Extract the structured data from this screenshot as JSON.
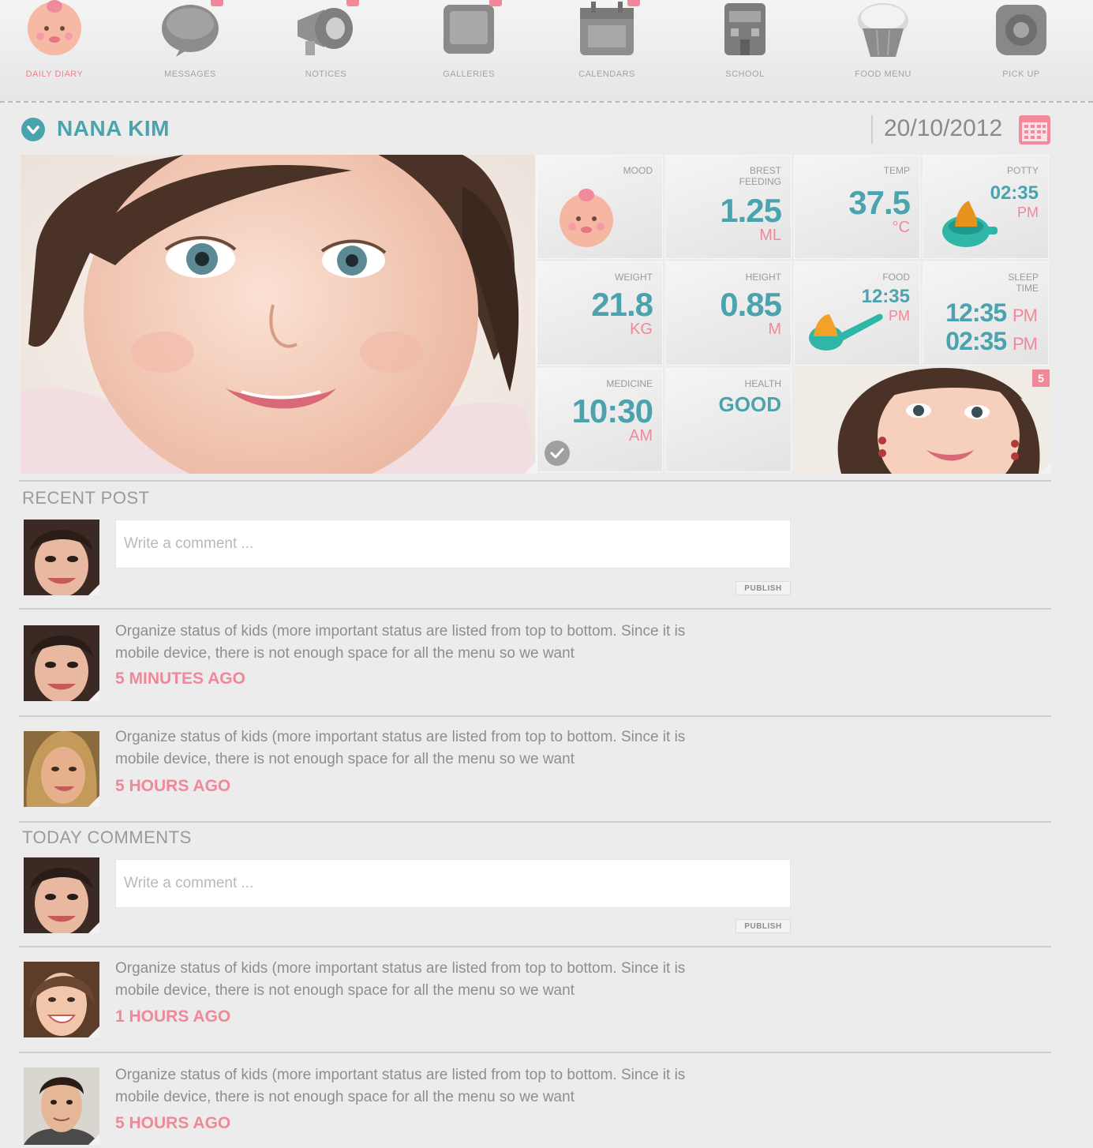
{
  "nav": {
    "items": [
      {
        "label": "Daily Diary",
        "icon": "baby-face-icon",
        "active": true,
        "badge": false
      },
      {
        "label": "Messages",
        "icon": "message-bubble-icon",
        "active": false,
        "badge": true
      },
      {
        "label": "Notices",
        "icon": "megaphone-icon",
        "active": false,
        "badge": true
      },
      {
        "label": "Galleries",
        "icon": "photo-frame-icon",
        "active": false,
        "badge": true
      },
      {
        "label": "Calendars",
        "icon": "calendar-icon",
        "active": false,
        "badge": true
      },
      {
        "label": "School",
        "icon": "school-building-icon",
        "active": false,
        "badge": false
      },
      {
        "label": "Food Menu",
        "icon": "cupcake-icon",
        "active": false,
        "badge": false
      },
      {
        "label": "Pick Up",
        "icon": "car-seat-icon",
        "active": false,
        "badge": false
      }
    ]
  },
  "child": {
    "name": "NANA KIM",
    "date": "20/10/2012"
  },
  "stats": {
    "mood": {
      "label": "MOOD"
    },
    "brest_feeding": {
      "label1": "BREST",
      "label2": "FEEDING",
      "value": "1.25",
      "unit": "ML"
    },
    "temp": {
      "label": "TEMP",
      "value": "37.5",
      "unit": "°C"
    },
    "potty": {
      "label": "POTTY",
      "time": "02:35",
      "ampm": "PM"
    },
    "weight": {
      "label": "WEIGHT",
      "value": "21.8",
      "unit": "KG"
    },
    "height": {
      "label": "HEIGHT",
      "value": "0.85",
      "unit": "M"
    },
    "food": {
      "label": "FOOD",
      "time": "12:35",
      "ampm": "PM"
    },
    "sleep": {
      "label1": "SLEEP",
      "label2": "TIME",
      "time1": "12:35",
      "ampm1": "PM",
      "time2": "02:35",
      "ampm2": "PM"
    },
    "medicine": {
      "label": "MEDICINE",
      "value": "10:30",
      "ampm": "AM"
    },
    "health": {
      "label": "HEALTH",
      "value": "GOOD"
    },
    "gallery_count": "5"
  },
  "recent_post": {
    "title": "RECENT POST",
    "placeholder": "Write a comment ...",
    "publish": "PUBLISH",
    "posts": [
      {
        "text1": "Organize status of kids (more important status are listed from top to bottom. Since it is",
        "text2": "mobile device, there is not enough space for all the menu so we want",
        "time": "5 MINUTES AGO"
      },
      {
        "text1": "Organize status of kids (more important status are listed from top to bottom. Since it is",
        "text2": "mobile device, there is not enough space for all the menu so we want",
        "time": "5 HOURS AGO"
      }
    ]
  },
  "today_comments": {
    "title": "TODAY COMMENTS",
    "placeholder": "Write a comment ...",
    "publish": "PUBLISH",
    "posts": [
      {
        "text1": "Organize status of kids (more important status are listed from top to bottom. Since it is",
        "text2": "mobile device, there is not enough space for all the menu so we want",
        "time": "1 HOURS AGO"
      },
      {
        "text1": "Organize status of kids (more important status are listed from top to bottom. Since it is",
        "text2": "mobile device, there is not enough space for all the menu so we want",
        "time": "5 HOURS AGO"
      }
    ]
  },
  "colors": {
    "accent_teal": "#4aa3ad",
    "accent_pink": "#f0889a",
    "background": "#ececec"
  }
}
